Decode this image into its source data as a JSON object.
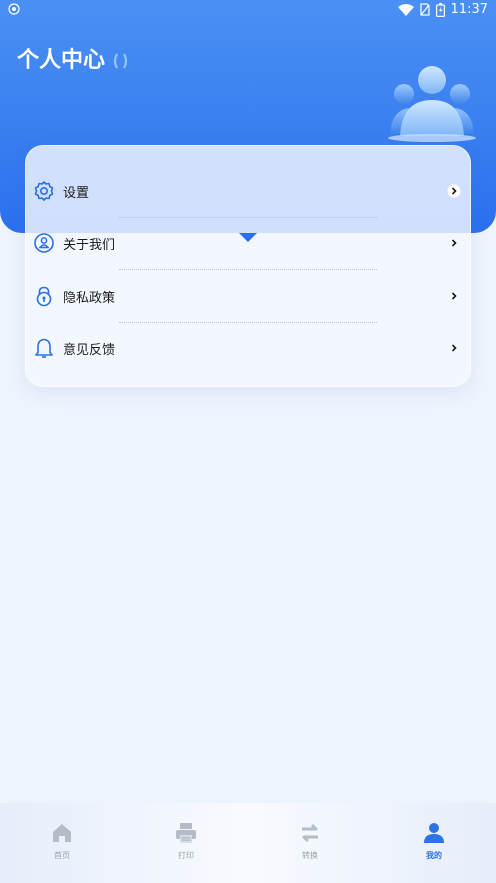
{
  "status_bar": {
    "time": "11:37"
  },
  "header": {
    "title": "个人中心"
  },
  "menu": {
    "items": [
      {
        "label": "设置",
        "icon": "gear-icon"
      },
      {
        "label": "关于我们",
        "icon": "user-circle-icon"
      },
      {
        "label": "隐私政策",
        "icon": "lock-icon"
      },
      {
        "label": "意见反馈",
        "icon": "bell-icon"
      }
    ]
  },
  "tabs": [
    {
      "label": "首页",
      "icon": "home-icon",
      "active": false
    },
    {
      "label": "打印",
      "icon": "printer-icon",
      "active": false
    },
    {
      "label": "转换",
      "icon": "swap-icon",
      "active": false
    },
    {
      "label": "我的",
      "icon": "user-icon",
      "active": true
    }
  ],
  "colors": {
    "primary": "#2c6ff0",
    "active_tab": "#2a74e8",
    "inactive_tab": "#9aa3b0"
  }
}
